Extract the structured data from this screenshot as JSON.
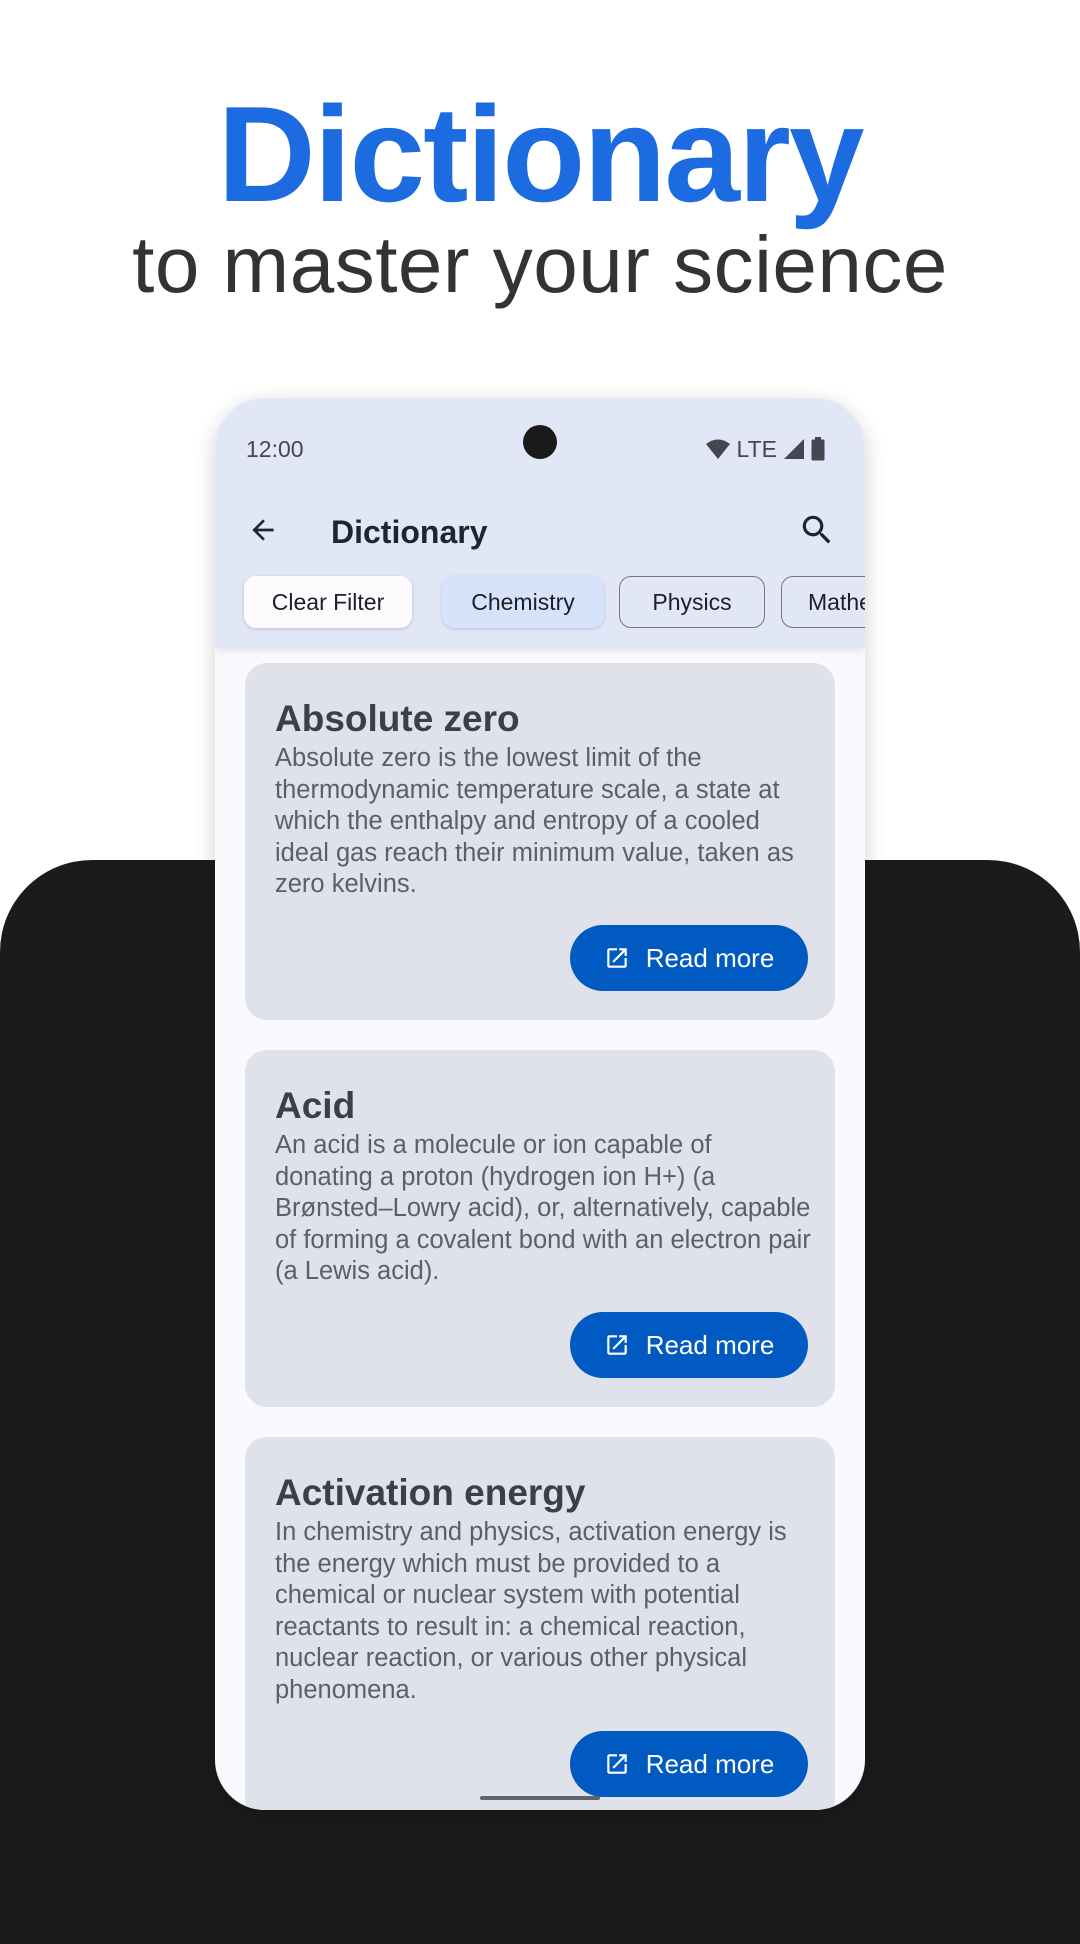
{
  "hero": {
    "title": "Dictionary",
    "subtitle": "to master your science",
    "title_color": "#1c6be0"
  },
  "status_bar": {
    "time": "12:00",
    "network": "LTE",
    "icons": [
      "wifi-icon",
      "cellular-signal-icon",
      "battery-icon"
    ]
  },
  "app_bar": {
    "title": "Dictionary",
    "back_icon": "arrow-left-icon",
    "search_icon": "search-icon"
  },
  "filters": {
    "clear_label": "Clear Filter",
    "chips": [
      {
        "label": "Chemistry",
        "selected": true
      },
      {
        "label": "Physics",
        "selected": false
      },
      {
        "label": "Mathe",
        "selected": false
      }
    ]
  },
  "entries": [
    {
      "title": "Absolute zero",
      "definition": "Absolute zero is the lowest limit of the thermodynamic temperature scale, a state at which the enthalpy and entropy of a cooled ideal gas reach their minimum value, taken as zero kelvins.",
      "action_label": "Read more",
      "action_icon": "open-in-new-icon"
    },
    {
      "title": "Acid",
      "definition": "An acid is a molecule or ion capable of donating a proton (hydrogen ion H+) (a Brønsted–Lowry acid), or, alternatively, capable of forming a covalent bond with an electron pair (a Lewis acid).",
      "action_label": "Read more",
      "action_icon": "open-in-new-icon"
    },
    {
      "title": "Activation energy",
      "definition": "In chemistry and physics, activation energy is the energy which must be provided to a chemical or nuclear system with potential reactants to result in: a chemical reaction, nuclear reaction, or various other physical phenomena.",
      "action_label": "Read more",
      "action_icon": "open-in-new-icon"
    }
  ],
  "colors": {
    "primary_button": "#005ac1",
    "app_bar_bg": "#e1e7f6",
    "card_bg": "#dfe2eb",
    "selected_chip_bg": "#d7e2fb",
    "dark_panel": "#1b1b1c"
  }
}
